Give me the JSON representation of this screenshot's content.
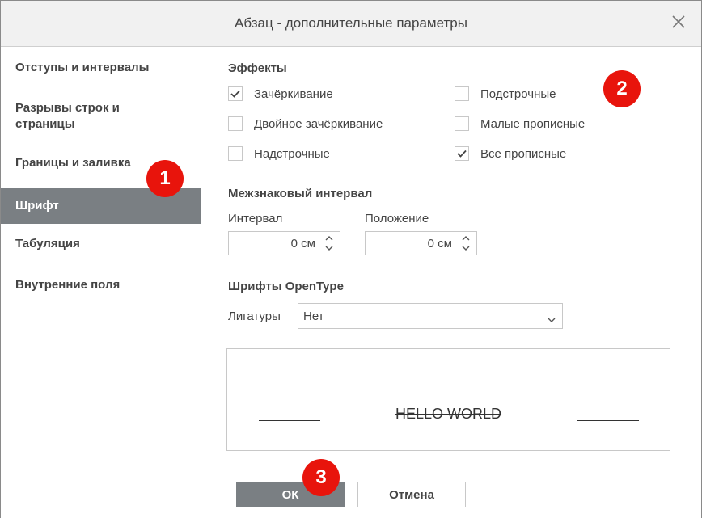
{
  "dialog": {
    "title": "Абзац - дополнительные параметры"
  },
  "sidebar": {
    "items": [
      {
        "label": "Отступы и интервалы"
      },
      {
        "label": "Разрывы строк и\nстраницы"
      },
      {
        "label": "Границы и заливка"
      },
      {
        "label": "Шрифт",
        "active": true
      },
      {
        "label": "Табуляция"
      },
      {
        "label": "Внутренние поля"
      }
    ]
  },
  "effects": {
    "title": "Эффекты",
    "items": [
      {
        "label": "Зачёркивание",
        "checked": true
      },
      {
        "label": "Двойное зачёркивание",
        "checked": false
      },
      {
        "label": "Надстрочные",
        "checked": false
      },
      {
        "label": "Подстрочные",
        "checked": false
      },
      {
        "label": "Малые прописные",
        "checked": false
      },
      {
        "label": "Все прописные",
        "checked": true
      }
    ]
  },
  "spacing": {
    "title": "Межзнаковый интервал",
    "interval_label": "Интервал",
    "interval_value": "0 см",
    "position_label": "Положение",
    "position_value": "0 см"
  },
  "opentype": {
    "title": "Шрифты OpenType",
    "ligatures_label": "Лигатуры",
    "ligatures_value": "Нет"
  },
  "preview": {
    "text": "HELLO WORLD"
  },
  "footer": {
    "ok_label": "ОК",
    "cancel_label": "Отмена"
  },
  "badges": {
    "one": "1",
    "two": "2",
    "three": "3"
  },
  "colors": {
    "active": "#7a7f83",
    "badge": "#e8140c",
    "title_bar": "#f1f1f1"
  }
}
